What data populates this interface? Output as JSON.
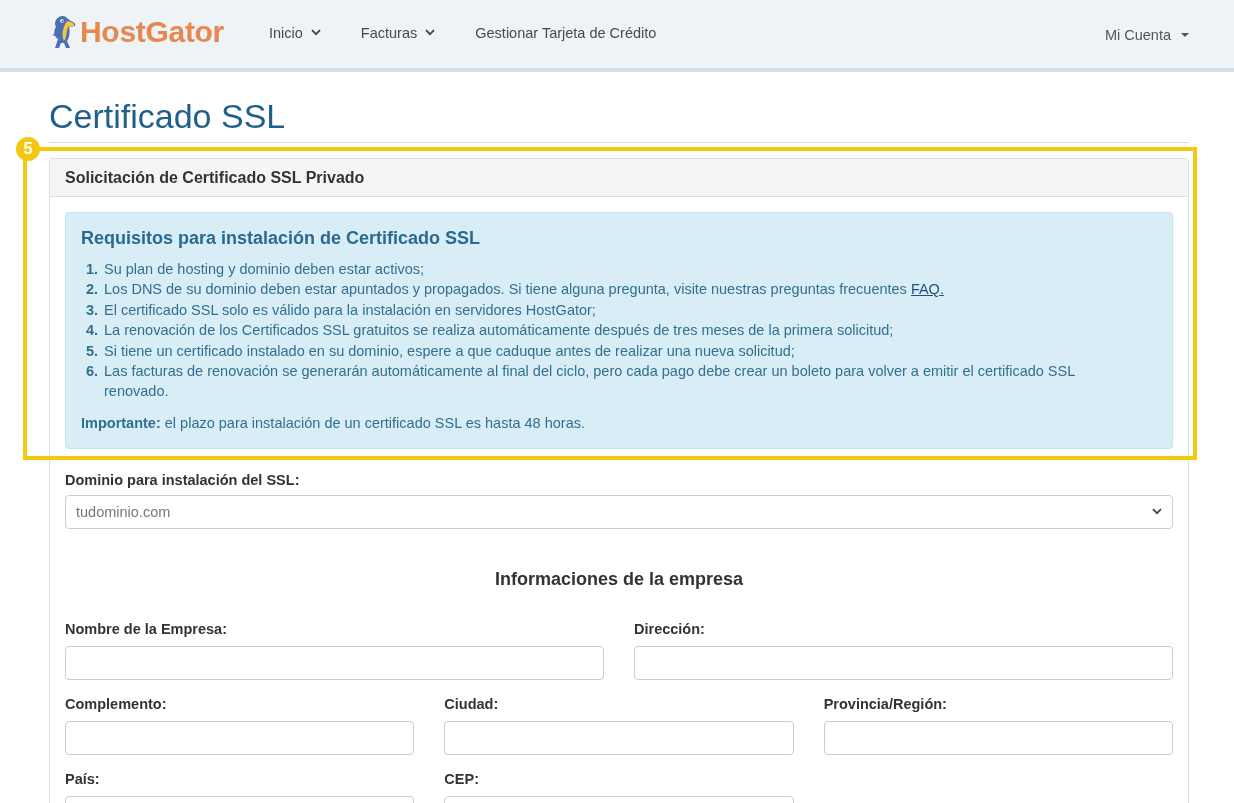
{
  "header": {
    "logo_text": "HostGator",
    "nav": [
      {
        "label": "Inicio",
        "has_menu": true
      },
      {
        "label": "Facturas",
        "has_menu": true
      },
      {
        "label": "Gestionar Tarjeta de Crédito",
        "has_menu": false
      }
    ],
    "account": {
      "label": "Mi Cuenta",
      "has_menu": true
    }
  },
  "page_title": "Certificado SSL",
  "highlight": {
    "step": "5"
  },
  "panel": {
    "title": "Solicitación de Certificado SSL Privado",
    "notice": {
      "title": "Requisitos para instalación de Certificado SSL",
      "items": [
        {
          "number": "1.",
          "text": "Su plan de hosting y dominio deben estar activos;"
        },
        {
          "number": "2.",
          "text": "Los DNS de su dominio deben estar apuntados y propagados. Si tiene alguna pregunta, visite nuestras preguntas frecuentes",
          "link": "FAQ."
        },
        {
          "number": "3.",
          "text": "El certificado SSL solo es válido para la instalación en servidores HostGator;"
        },
        {
          "number": "4.",
          "text": "La renovación de los Certificados SSL gratuitos se realiza automáticamente después de tres meses de la primera solicitud;"
        },
        {
          "number": "5.",
          "text": "Si tiene un certificado instalado en su dominio, espere a que caduque antes de realizar una nueva solicitud;"
        },
        {
          "number": "6.",
          "text": "Las facturas de renovación se generarán automáticamente al final del ciclo, pero cada pago debe crear un boleto para volver a emitir el certificado SSL renovado."
        }
      ],
      "note": "**Importante:** el plazo para instalación de un certificado SSL es hasta 48 horas."
    },
    "domain_field": {
      "label": "Dominio para instalación del SSL:",
      "value": "tudominio.com"
    },
    "section_title": "Informaciones de la empresa",
    "field_rows": [
      {
        "fields": [
          {
            "label": "Nombre de la Empresa:"
          },
          {
            "label": "Dirección:"
          }
        ]
      },
      {
        "fields": [
          {
            "label": "Complemento:"
          },
          {
            "label": "Ciudad:"
          },
          {
            "label": "Provincia/Región:"
          }
        ]
      },
      {
        "fields": [
          {
            "label": "País:"
          },
          {
            "label": "CEP:"
          }
        ]
      }
    ]
  }
}
